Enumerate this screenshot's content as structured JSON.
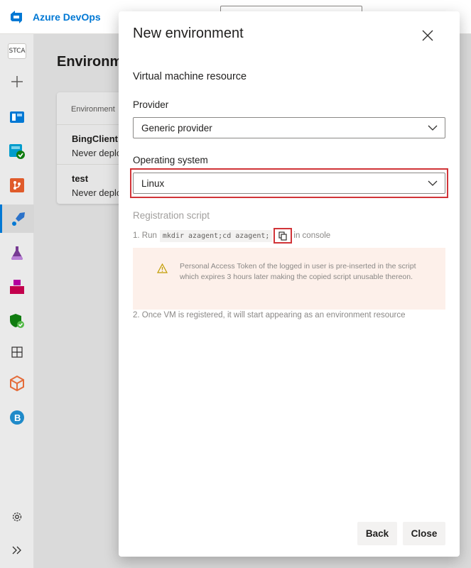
{
  "app": {
    "name": "Azure DevOps",
    "org_initials": "STCA"
  },
  "page": {
    "title": "Environments",
    "table_header": "Environment",
    "environments": [
      {
        "name": "BingClient",
        "status": "Never deployed"
      },
      {
        "name": "test",
        "status": "Never deployed"
      }
    ]
  },
  "left_nav": [
    {
      "icon": "org-avatar-icon"
    },
    {
      "icon": "plus-icon"
    },
    {
      "icon": "boards-icon",
      "color": "#0078d4"
    },
    {
      "icon": "repos-check-icon",
      "color": "#009ccc"
    },
    {
      "icon": "repos-icon",
      "color": "#e05b2b"
    },
    {
      "icon": "pipelines-icon",
      "color": "#2b72c9",
      "active": true
    },
    {
      "icon": "test-plans-icon",
      "color": "#773b93"
    },
    {
      "icon": "artifacts-icon",
      "color": "#b4009e"
    },
    {
      "icon": "security-shield-icon",
      "color": "#107c10"
    },
    {
      "icon": "grid-icon"
    },
    {
      "icon": "package-icon",
      "color": "#e46c3a"
    },
    {
      "icon": "b-circle-icon",
      "color": "#1f8ac9"
    }
  ],
  "left_nav_bottom": [
    {
      "icon": "gear-icon"
    },
    {
      "icon": "expand-chevrons-icon"
    }
  ],
  "dialog": {
    "title": "New environment",
    "section": "Virtual machine resource",
    "provider_label": "Provider",
    "provider_value": "Generic provider",
    "os_label": "Operating system",
    "os_value": "Linux",
    "registration_label": "Registration script",
    "step1_prefix": "1. Run",
    "step1_code": "mkdir azagent;cd azagent;",
    "step1_suffix": "in console",
    "warning": "Personal Access Token of the logged in user is pre-inserted in the script which expires 3 hours later making the copied script unusable thereon.",
    "step2": "2. Once VM is registered, it will start appearing as an environment resource",
    "back_label": "Back",
    "close_label": "Close"
  },
  "colors": {
    "accent": "#0078d4",
    "highlight": "#d13438",
    "warning_bg": "#fdf0ea",
    "warning_icon": "#c19c00"
  }
}
